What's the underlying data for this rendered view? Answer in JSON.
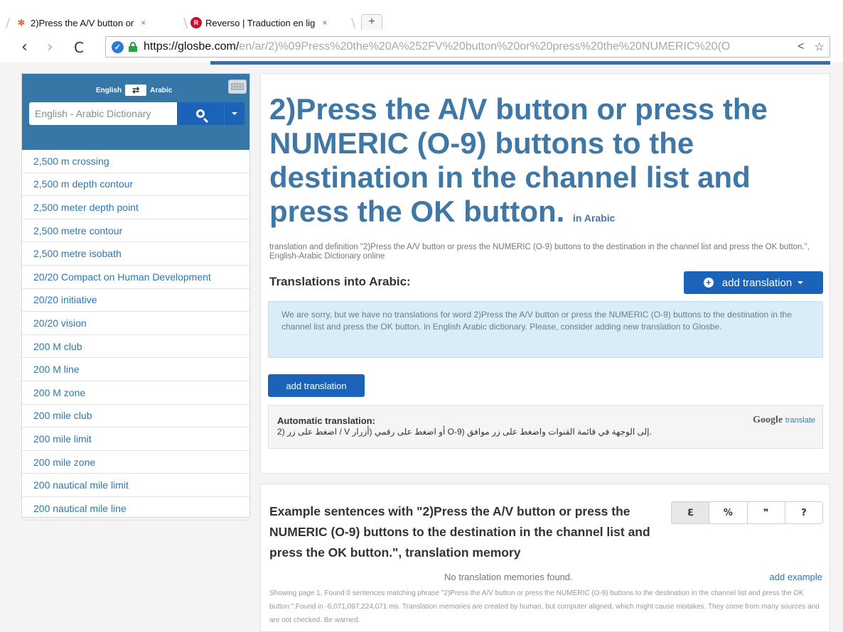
{
  "browser": {
    "tabs": [
      {
        "title": "2)Press the A/V button or",
        "close": "×"
      },
      {
        "title": "Reverso | Traduction en lig",
        "close": "×"
      }
    ],
    "new_tab": "+",
    "nav": {
      "back": "‹",
      "forward": "›",
      "reload": "C"
    },
    "url_host": "https://glosbe.com/",
    "url_path": "en/ar/2)%09Press%20the%20A%252FV%20button%20or%20press%20the%20NUMERIC%20(O",
    "share": "<",
    "star": "☆"
  },
  "sidebar": {
    "lang_from": "English",
    "lang_swap": "⇄",
    "lang_to": "Arabic",
    "search_placeholder": "English - Arabic Dictionary",
    "items": [
      "2,500 m crossing",
      "2,500 m depth contour",
      "2,500 meter depth point",
      "2,500 metre contour",
      "2,500 metre isobath",
      "20/20 Compact on Human Development",
      "20/20 initiative",
      "20/20 vision",
      "200 M club",
      "200 M line",
      "200 M zone",
      "200 mile club",
      "200 mile limit",
      "200 mile zone",
      "200 nautical mile limit",
      "200 nautical mile line"
    ]
  },
  "main": {
    "headline": "2)Press the A/V button or press the NUMERIC (O-9) buttons to the destination in the channel list and press the OK button.",
    "in_lang": "in Arabic",
    "description": "translation and definition \"2)Press the A/V button or press the NUMERIC (O-9) buttons to the destination in the channel list and press the OK button.\", English-Arabic Dictionary  online",
    "translations_title": "Translations into Arabic:",
    "add_translation_dropdown": "add translation",
    "alert": "We are sorry, but we have no translations for word 2)Press the A/V button or press the NUMERIC (O-9) buttons to the destination in the channel list and press the OK button. in English Arabic dictionary. Please, consider adding new translation to Glosbe.",
    "add_translation_button": "add translation",
    "auto_label": "Automatic translation:",
    "auto_text": ".إلى الوجهة في قائمة القنوات واضغط على زر موافق (O-9 أو اضغط على رقمي (أزرار V / اضغط على زر (2",
    "google_brand": "Google",
    "google_suffix": "translate"
  },
  "examples": {
    "title": "Example sentences with \"2)Press the A/V button or press the NUMERIC (O-9) buttons to the destination in the channel list and press the OK button.\", translation memory",
    "buttons": [
      "ℇ",
      "%",
      "❞",
      "?"
    ],
    "no_memories": "No translation memories found.",
    "add_example": "add example",
    "small_print": "Showing page 1. Found 0 sentences matching phrase \"2)Press the A/V button or press the NUMERIC (O-9) buttons to the destination in the channel list and press the OK button.\".Found in -6,071,097,224,071 ms. Translation memories are created by human, but computer aligned, which might cause mistakes. They come from many sources and are not checked. Be warned."
  },
  "colors": {
    "accent": "#3f78a6",
    "button_blue": "#1a63b9",
    "sidebar_header": "#3777a7",
    "link": "#2d77b3"
  }
}
